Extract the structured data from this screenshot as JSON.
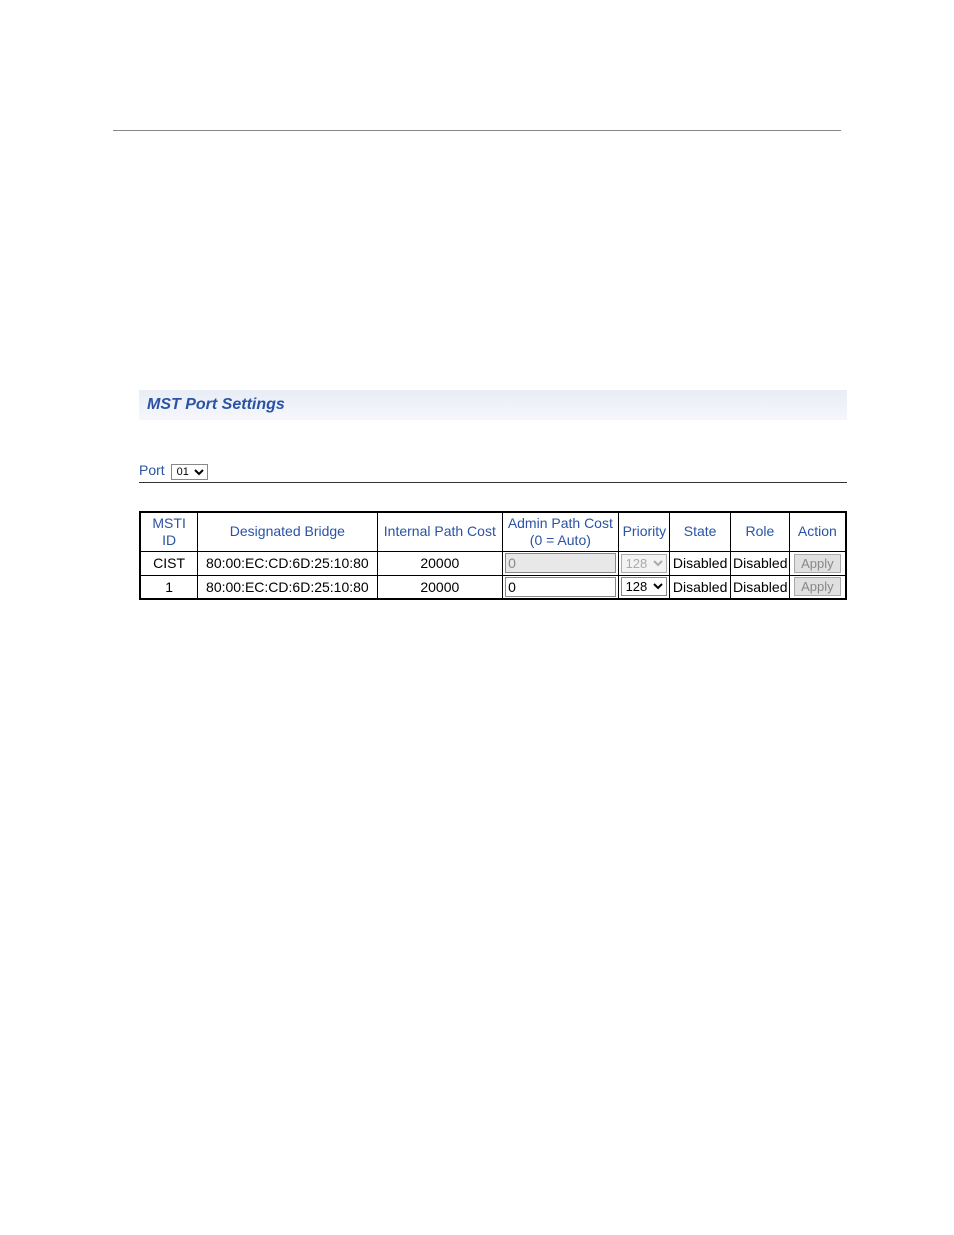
{
  "page": {
    "title": "MST Port Settings"
  },
  "portSelector": {
    "label": "Port",
    "value": "01"
  },
  "table": {
    "headers": {
      "msti_id": "MSTI ID",
      "designated_bridge": "Designated Bridge",
      "internal_path_cost": "Internal Path Cost",
      "admin_path_cost_line1": "Admin Path Cost",
      "admin_path_cost_line2": "(0 = Auto)",
      "priority": "Priority",
      "state": "State",
      "role": "Role",
      "action": "Action"
    },
    "rows": [
      {
        "msti_id": "CIST",
        "designated_bridge": "80:00:EC:CD:6D:25:10:80",
        "internal_path_cost": "20000",
        "admin_path_cost": "0",
        "admin_disabled": true,
        "priority": "128",
        "priority_disabled": true,
        "state": "Disabled",
        "role": "Disabled",
        "action_label": "Apply"
      },
      {
        "msti_id": "1",
        "designated_bridge": "80:00:EC:CD:6D:25:10:80",
        "internal_path_cost": "20000",
        "admin_path_cost": "0",
        "admin_disabled": false,
        "priority": "128",
        "priority_disabled": false,
        "state": "Disabled",
        "role": "Disabled",
        "action_label": "Apply"
      }
    ]
  }
}
